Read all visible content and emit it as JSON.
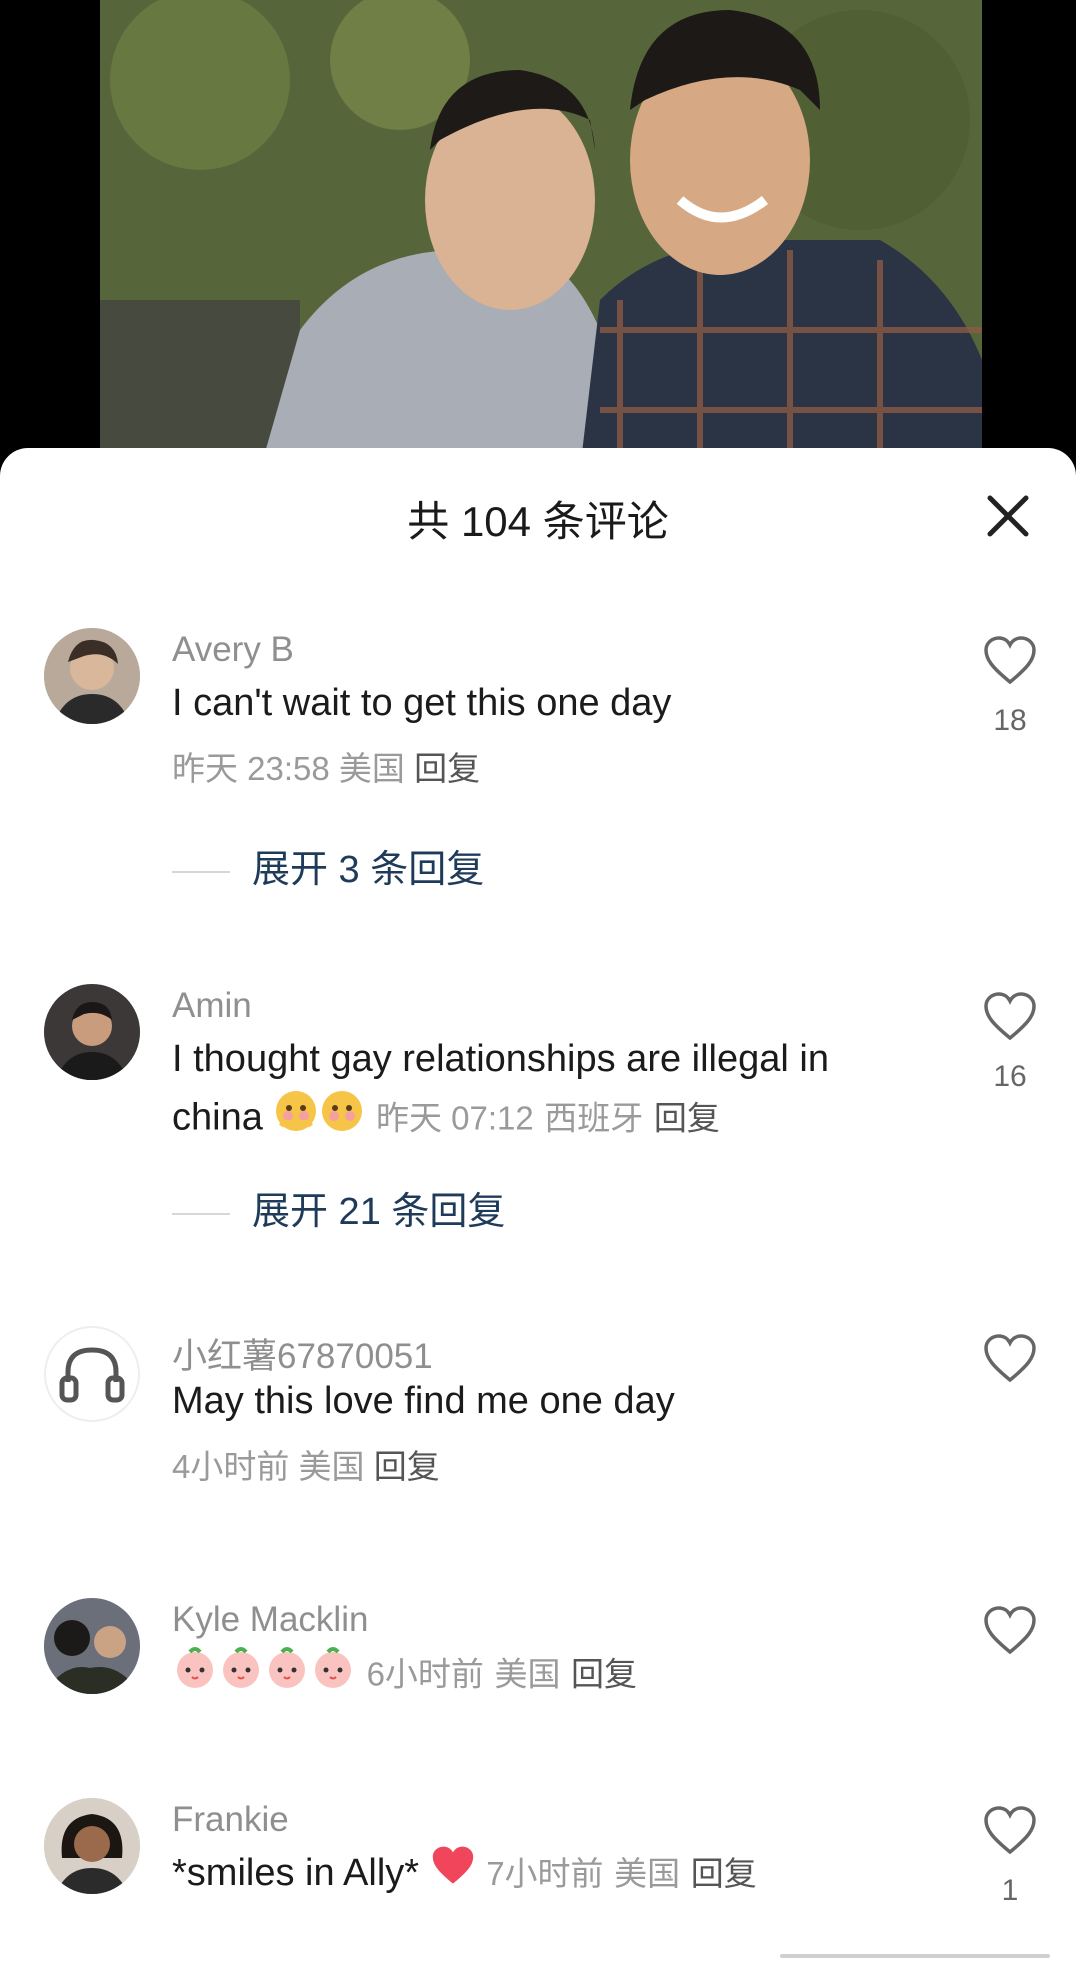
{
  "header": {
    "title": "共 104 条评论"
  },
  "comments": [
    {
      "user": "Avery B",
      "text": "I can't wait to get this one day",
      "time": "昨天 23:58",
      "location": "美国",
      "reply": "回复",
      "likes": "18",
      "expand": "展开 3 条回复"
    },
    {
      "user": "Amin",
      "text1": "I thought gay relationships are illegal in",
      "text2": "china",
      "time": "昨天 07:12",
      "location": "西班牙",
      "reply": "回复",
      "likes": "16",
      "expand": "展开 21 条回复"
    },
    {
      "user": "小红薯67870051",
      "text": "May this love find me one day",
      "time": "4小时前",
      "location": "美国",
      "reply": "回复",
      "likes": ""
    },
    {
      "user": "Kyle Macklin",
      "time": "6小时前",
      "location": "美国",
      "reply": "回复",
      "likes": ""
    },
    {
      "user": "Frankie",
      "text": "*smiles in Ally*",
      "time": "7小时前",
      "location": "美国",
      "reply": "回复",
      "likes": "1"
    }
  ],
  "colors": {
    "expand": "#1f3b5a",
    "meta": "#9a9a9a",
    "heart": "#666666"
  }
}
